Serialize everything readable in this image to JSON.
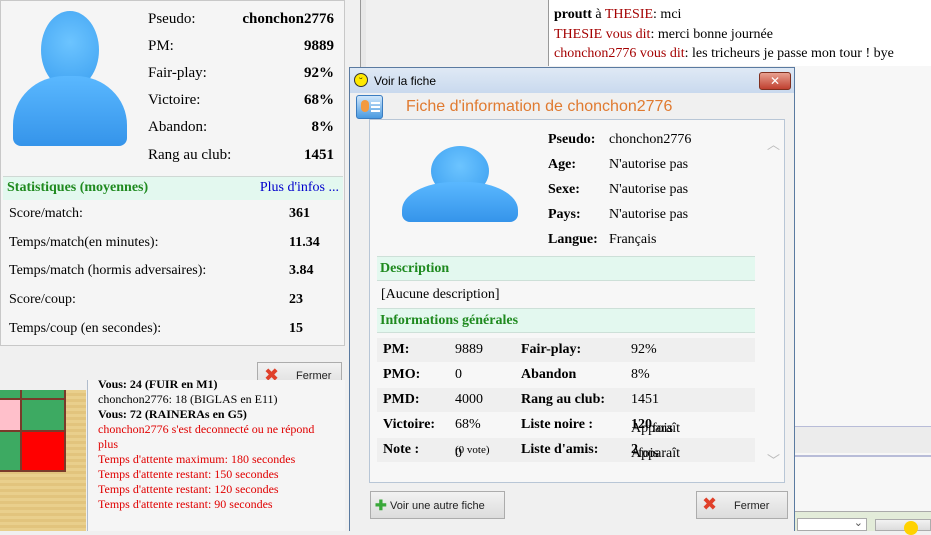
{
  "profile_panel": {
    "rows": [
      {
        "label": "Pseudo:",
        "value": "chonchon2776"
      },
      {
        "label": "PM:",
        "value": "9889"
      },
      {
        "label": "Fair-play:",
        "value": "92%"
      },
      {
        "label": "Victoire:",
        "value": "68%"
      },
      {
        "label": "Abandon:",
        "value": "8%"
      },
      {
        "label": "Rang au club:",
        "value": "1451"
      }
    ],
    "stats_header": "Statistiques (moyennes)",
    "more_info_link": "Plus d'infos ...",
    "stats": [
      {
        "label": "Score/match:",
        "value": "361"
      },
      {
        "label": "Temps/match(en minutes):",
        "value": "11.34"
      },
      {
        "label": "Temps/match (hormis adversaires):",
        "value": "3.84"
      },
      {
        "label": "Score/coup:",
        "value": "23"
      },
      {
        "label": "Temps/coup (en secondes):",
        "value": "15"
      }
    ],
    "close_label": "Fermer"
  },
  "game_log": {
    "lines": [
      {
        "text": "Vous: 24 (FUIR en M1)",
        "style": "bold"
      },
      {
        "text": "chonchon2776: 18 (BIGLAS en E11)",
        "style": "normal"
      },
      {
        "text": "Vous: 72 (RAINERAs en G5)",
        "style": "bold"
      },
      {
        "text": "chonchon2776 s'est deconnecté ou ne répond plus",
        "style": "red"
      },
      {
        "text": "Temps d'attente maximum: 180 secondes",
        "style": "red"
      },
      {
        "text": "Temps d'attente restant: 150 secondes",
        "style": "red"
      },
      {
        "text": "Temps d'attente restant: 120 secondes",
        "style": "red"
      },
      {
        "text": "Temps d'attente restant: 90 secondes",
        "style": "red"
      }
    ]
  },
  "chat": {
    "lines": [
      {
        "sender": "proutt",
        "mid": " à ",
        "target": "THESIE",
        "msg": ": mci"
      },
      {
        "sender": "THESIE vous dit",
        "msg": ": merci bonne journée"
      },
      {
        "sender": "chonchon2776 vous dit",
        "msg": ": les tricheurs je passe mon tour ! bye"
      }
    ]
  },
  "dialog": {
    "window_title": "Voir la fiche",
    "heading": "Fiche d'information de chonchon2776",
    "info": [
      {
        "label": "Pseudo:",
        "value": "chonchon2776"
      },
      {
        "label": "Age:",
        "value": "N'autorise pas"
      },
      {
        "label": "Sexe:",
        "value": "N'autorise pas"
      },
      {
        "label": "Pays:",
        "value": "N'autorise pas"
      },
      {
        "label": "Langue:",
        "value": "Français"
      }
    ],
    "description_header": "Description",
    "description": "[Aucune description]",
    "general_header": "Informations générales",
    "general": [
      {
        "l1": "PM:",
        "v1": "9889",
        "l2": "Fair-play:",
        "v2": "92%"
      },
      {
        "l1": "PMO:",
        "v1": "0",
        "l2": "Abandon",
        "v2": "8%"
      },
      {
        "l1": "PMD:",
        "v1": "4000",
        "l2": "Rang au club:",
        "v2": "1451"
      },
      {
        "l1": "Victoire:",
        "v1": "68%",
        "l2": "Liste noire :",
        "v2a": "Apparaît ",
        "v2b": "120",
        "v2c": " fois"
      },
      {
        "l1": "Note :",
        "v1": "0",
        "v1small": "(0 vote)",
        "l2": "Liste d'amis:",
        "v2a": "Apparaît ",
        "v2b": "2",
        "v2c": " fois"
      }
    ],
    "other_button": "Voir une autre fiche",
    "close_button": "Fermer"
  },
  "colors": {
    "accent_green": "#1f8a1f",
    "heading_orange": "#e07a30",
    "link_blue": "#0000cc",
    "error_red": "#e00000"
  }
}
